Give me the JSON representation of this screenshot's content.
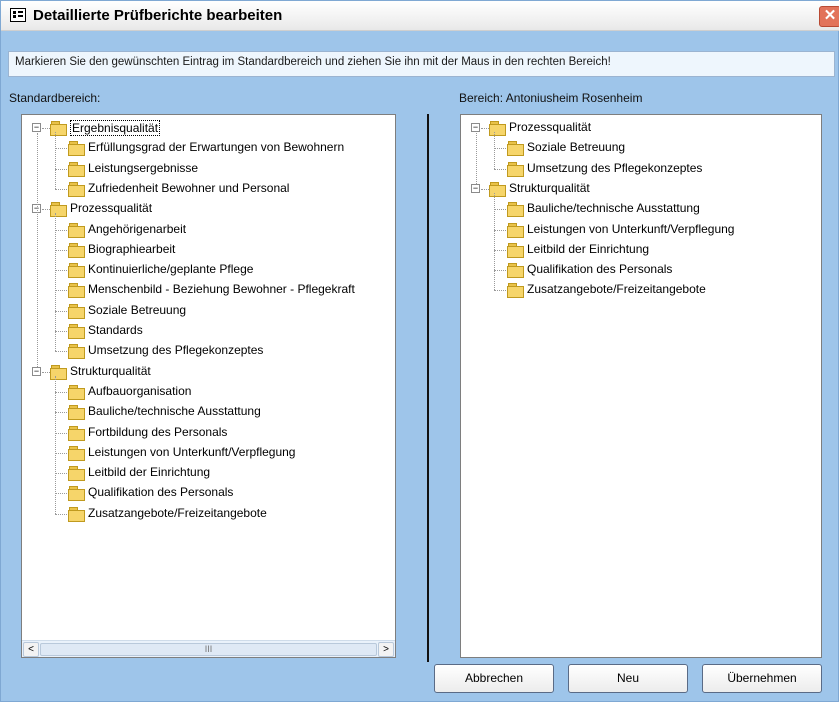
{
  "window": {
    "title": "Detaillierte Prüfberichte bearbeiten",
    "close_glyph": "✕"
  },
  "hint": "Markieren Sie den gewünschten Eintrag im Standardbereich und ziehen Sie ihn mit der Maus in den rechten Bereich!",
  "left": {
    "label": "Standardbereich:",
    "groups": [
      {
        "label": "Ergebnisqualität",
        "items": [
          "Erfüllungsgrad der Erwartungen von Bewohnern",
          "Leistungsergebnisse",
          "Zufriedenheit Bewohner und Personal"
        ]
      },
      {
        "label": "Prozessqualität",
        "items": [
          "Angehörigenarbeit",
          "Biographiearbeit",
          "Kontinuierliche/geplante Pflege",
          "Menschenbild - Beziehung Bewohner - Pflegekraft",
          "Soziale Betreuung",
          "Standards",
          "Umsetzung des Pflegekonzeptes"
        ]
      },
      {
        "label": "Strukturqualität",
        "items": [
          "Aufbauorganisation",
          "Bauliche/technische Ausstattung",
          "Fortbildung des Personals",
          "Leistungen von Unterkunft/Verpflegung",
          "Leitbild der Einrichtung",
          "Qualifikation des Personals",
          "Zusatzangebote/Freizeitangebote"
        ]
      }
    ],
    "scroll_left": "<",
    "scroll_right": ">",
    "scroll_thumb": "III"
  },
  "right": {
    "label": "Bereich: Antoniusheim Rosenheim",
    "groups": [
      {
        "label": "Prozessqualität",
        "items": [
          "Soziale Betreuung",
          "Umsetzung des Pflegekonzeptes"
        ]
      },
      {
        "label": "Strukturqualität",
        "items": [
          "Bauliche/technische Ausstattung",
          "Leistungen von Unterkunft/Verpflegung",
          "Leitbild der Einrichtung",
          "Qualifikation des Personals",
          "Zusatzangebote/Freizeitangebote"
        ]
      }
    ]
  },
  "buttons": {
    "cancel": "Abbrechen",
    "new": "Neu",
    "apply": "Übernehmen"
  },
  "icons": {
    "tree_collapse": "⊟",
    "folder": "folder-icon"
  }
}
